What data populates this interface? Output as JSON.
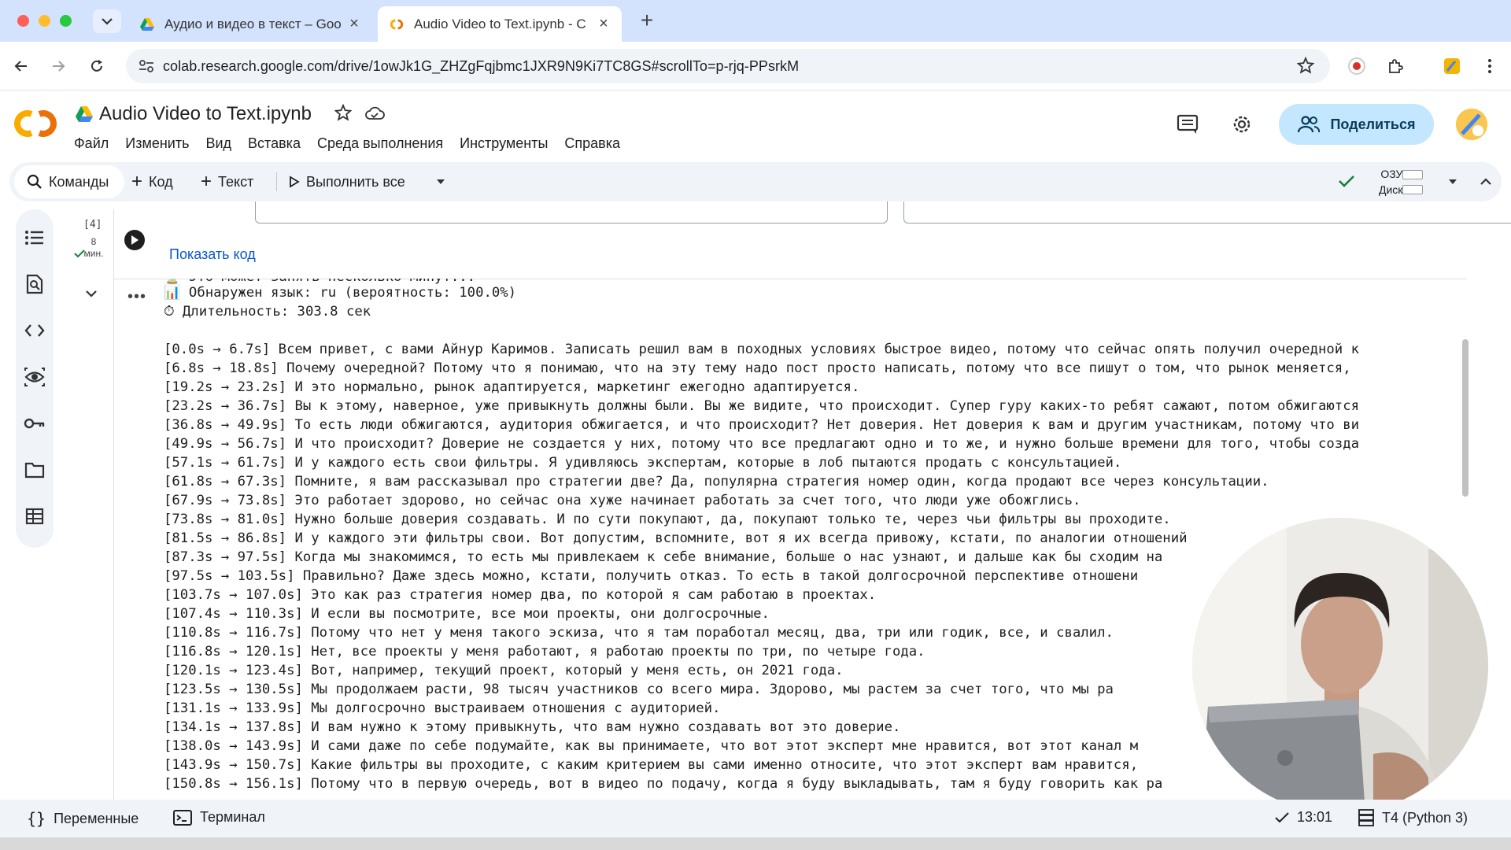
{
  "browser": {
    "tabs": [
      {
        "title": "Аудио и видео в текст – Goo",
        "active": false
      },
      {
        "title": "Audio Video to Text.ipynb - C",
        "active": true
      }
    ],
    "url": "colab.research.google.com/drive/1owJk1G_ZHZgFqjbmc1JXR9N9Ki7TC8GS#scrollTo=p-rjq-PPsrkM"
  },
  "colab": {
    "doc_title": "Audio Video to Text.ipynb",
    "menu": [
      "Файл",
      "Изменить",
      "Вид",
      "Вставка",
      "Среда выполнения",
      "Инструменты",
      "Справка"
    ],
    "share_label": "Поделиться",
    "toolbar": {
      "commands": "Команды",
      "add_code": "Код",
      "add_text": "Текст",
      "run_all": "Выполнить все",
      "ram": "ОЗУ",
      "disk": "Диск"
    }
  },
  "cell": {
    "exec_count": "[4]",
    "exec_time_value": "8",
    "exec_time_unit": "мин.",
    "show_code": "Показать код",
    "output_lines": [
      "⏳ Это может занять несколько минут...",
      "📊 Обнаружен язык: ru (вероятность: 100.0%)",
      "⏱ Длительность: 303.8 сек",
      "",
      "[0.0s → 6.7s] Всем привет, с вами Айнур Каримов. Записать решил вам в походных условиях быстрое видео, потому что сейчас опять получил очередной к",
      "[6.8s → 18.8s] Почему очередной? Потому что я понимаю, что на эту тему надо пост просто написать, потому что все пишут о том, что рынок меняется, ",
      "[19.2s → 23.2s] И это нормально, рынок адаптируется, маркетинг ежегодно адаптируется.",
      "[23.2s → 36.7s] Вы к этому, наверное, уже привыкнуть должны были. Вы же видите, что происходит. Супер гуру каких-то ребят сажают, потом обжигаются",
      "[36.8s → 49.9s] То есть люди обжигаются, аудитория обжигается, и что происходит? Нет доверия. Нет доверия к вам и другим участникам, потому что ви",
      "[49.9s → 56.7s] И что происходит? Доверие не создается у них, потому что все предлагают одно и то же, и нужно больше времени для того, чтобы созда",
      "[57.1s → 61.7s] И у каждого есть свои фильтры. Я удивляюсь экспертам, которые в лоб пытаются продать с консультацией.",
      "[61.8s → 67.3s] Помните, я вам рассказывал про стратегии две? Да, популярна стратегия номер один, когда продают все через консультации.",
      "[67.9s → 73.8s] Это работает здорово, но сейчас она хуже начинает работать за счет того, что люди уже обожглись.",
      "[73.8s → 81.0s] Нужно больше доверия создавать. И по сути покупают, да, покупают только те, через чьи фильтры вы проходите.",
      "[81.5s → 86.8s] И у каждого эти фильтры свои. Вот допустим, вспомните, вот я их всегда привожу, кстати, по аналогии отношений",
      "[87.3s → 97.5s] Когда мы знакомимся, то есть мы привлекаем к себе внимание, больше о нас узнают, и дальше как бы сходим на",
      "[97.5s → 103.5s] Правильно? Даже здесь можно, кстати, получить отказ. То есть в такой долгосрочной перспективе отношени",
      "[103.7s → 107.0s] Это как раз стратегия номер два, по которой я сам работаю в проектах.",
      "[107.4s → 110.3s] И если вы посмотрите, все мои проекты, они долгосрочные.",
      "[110.8s → 116.7s] Потому что нет у меня такого эскиза, что я там поработал месяц, два, три или годик, все, и свалил.",
      "[116.8s → 120.1s] Нет, все проекты у меня работают, я работаю проекты по три, по четыре года.",
      "[120.1s → 123.4s] Вот, например, текущий проект, который у меня есть, он 2021 года.",
      "[123.5s → 130.5s] Мы продолжаем расти, 98 тысяч участников со всего мира. Здорово, мы растем за счет того, что мы ра",
      "[131.1s → 133.9s] Мы долгосрочно выстраиваем отношения с аудиторией.",
      "[134.1s → 137.8s] И вам нужно к этому привыкнуть, что вам нужно создавать вот это доверие.",
      "[138.0s → 143.9s] И сами даже по себе подумайте, как вы принимаете, что вот этот эксперт мне нравится, вот этот канал м",
      "[143.9s → 150.7s] Какие фильтры вы проходите, с каким критерием вы сами именно относите, что этот эксперт вам нравится,",
      "[150.8s → 156.1s] Потому что в первую очередь, вот в видео по подачу, когда я буду выкладывать, там я буду говорить как ра"
    ]
  },
  "statusbar": {
    "variables": "Переменные",
    "terminal": "Терминал",
    "time": "13:01",
    "runtime": "T4 (Python 3)"
  }
}
